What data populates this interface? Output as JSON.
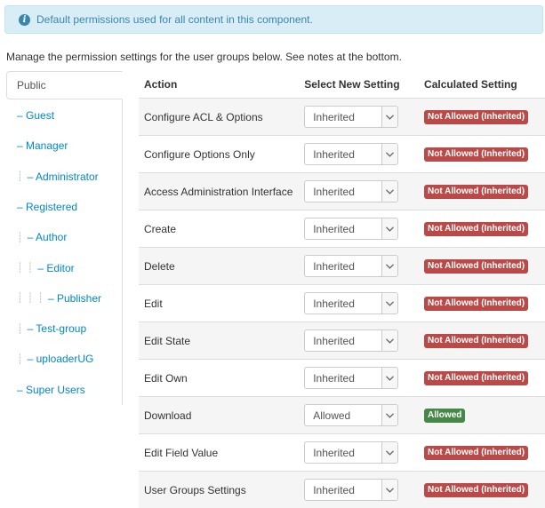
{
  "alert": {
    "icon": "info-icon",
    "message": "Default permissions used for all content in this component."
  },
  "intro": "Manage the permission settings for the user groups below. See notes at the bottom.",
  "sidebar": {
    "items": [
      {
        "label": "Public",
        "guide": ""
      },
      {
        "label": "– Guest",
        "guide": ""
      },
      {
        "label": "– Manager",
        "guide": ""
      },
      {
        "label": "– Administrator",
        "guide": "┊"
      },
      {
        "label": "– Registered",
        "guide": ""
      },
      {
        "label": "– Author",
        "guide": "┊"
      },
      {
        "label": "– Editor",
        "guide": "┊ ┊"
      },
      {
        "label": "– Publisher",
        "guide": "┊ ┊ ┊"
      },
      {
        "label": "– Test-group",
        "guide": "┊"
      },
      {
        "label": "– uploaderUG",
        "guide": "┊"
      },
      {
        "label": "– Super Users",
        "guide": ""
      }
    ]
  },
  "table": {
    "headers": {
      "action": "Action",
      "select": "Select New Setting",
      "calc": "Calculated Setting"
    },
    "rows": [
      {
        "action": "Configure ACL & Options",
        "setting": "Inherited",
        "calc": "Not Allowed (Inherited)",
        "calc_status": "not-allowed"
      },
      {
        "action": "Configure Options Only",
        "setting": "Inherited",
        "calc": "Not Allowed (Inherited)",
        "calc_status": "not-allowed"
      },
      {
        "action": "Access Administration Interface",
        "setting": "Inherited",
        "calc": "Not Allowed (Inherited)",
        "calc_status": "not-allowed"
      },
      {
        "action": "Create",
        "setting": "Inherited",
        "calc": "Not Allowed (Inherited)",
        "calc_status": "not-allowed"
      },
      {
        "action": "Delete",
        "setting": "Inherited",
        "calc": "Not Allowed (Inherited)",
        "calc_status": "not-allowed"
      },
      {
        "action": "Edit",
        "setting": "Inherited",
        "calc": "Not Allowed (Inherited)",
        "calc_status": "not-allowed"
      },
      {
        "action": "Edit State",
        "setting": "Inherited",
        "calc": "Not Allowed (Inherited)",
        "calc_status": "not-allowed"
      },
      {
        "action": "Edit Own",
        "setting": "Inherited",
        "calc": "Not Allowed (Inherited)",
        "calc_status": "not-allowed"
      },
      {
        "action": "Download",
        "setting": "Allowed",
        "calc": "Allowed",
        "calc_status": "allowed"
      },
      {
        "action": "Edit Field Value",
        "setting": "Inherited",
        "calc": "Not Allowed (Inherited)",
        "calc_status": "not-allowed"
      },
      {
        "action": "User Groups Settings",
        "setting": "Inherited",
        "calc": "Not Allowed (Inherited)",
        "calc_status": "not-allowed"
      }
    ]
  },
  "colors": {
    "not_allowed": "#b94a48",
    "allowed": "#468847",
    "link": "#0088cc",
    "alert_bg": "#d9edf7"
  },
  "icons": {
    "select_caret": "chevron-down-icon"
  }
}
